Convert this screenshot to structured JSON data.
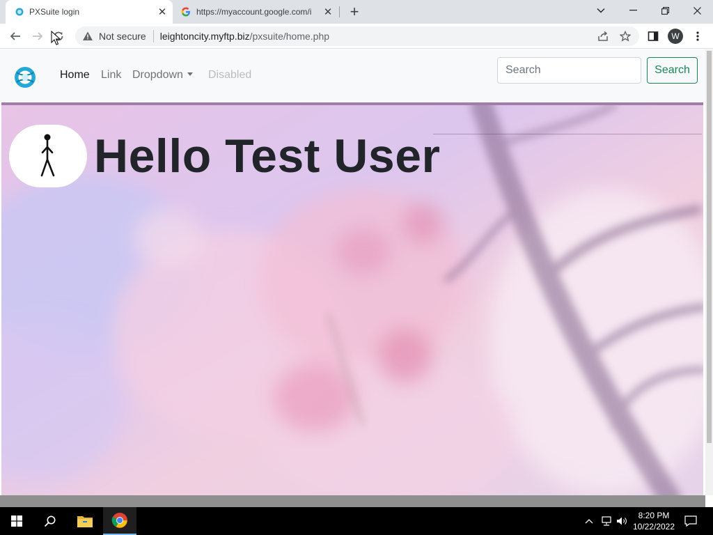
{
  "browser": {
    "tabs": [
      {
        "title": "PXSuite login",
        "active": true
      },
      {
        "title": "https://myaccount.google.com/i",
        "active": false
      }
    ],
    "new_tab_label": "+",
    "not_secure_label": "Not secure",
    "url_host": "leightoncity.myftp.biz",
    "url_path": "/pxsuite/home.php",
    "profile_initial": "W"
  },
  "navbar": {
    "links": {
      "home": "Home",
      "link": "Link",
      "dropdown": "Dropdown",
      "disabled": "Disabled"
    },
    "search_placeholder": "Search",
    "search_button": "Search"
  },
  "hero": {
    "greeting": "Hello Test User"
  },
  "taskbar": {
    "time": "8:20 PM",
    "date": "10/22/2022"
  },
  "colors": {
    "accent_green": "#198754",
    "navbar_bg": "#f8f9fa",
    "hero_pink": "#e8c6e0"
  }
}
